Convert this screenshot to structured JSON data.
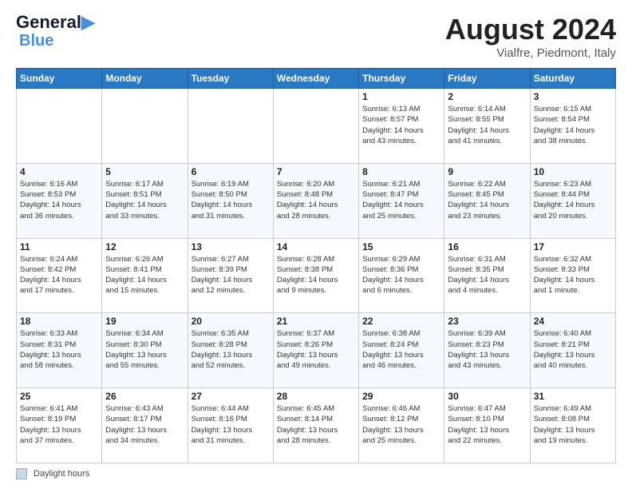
{
  "logo": {
    "line1": "General",
    "line2": "Blue"
  },
  "header": {
    "month": "August 2024",
    "location": "Vialfre, Piedmont, Italy"
  },
  "days_of_week": [
    "Sunday",
    "Monday",
    "Tuesday",
    "Wednesday",
    "Thursday",
    "Friday",
    "Saturday"
  ],
  "weeks": [
    [
      {
        "day": "",
        "info": ""
      },
      {
        "day": "",
        "info": ""
      },
      {
        "day": "",
        "info": ""
      },
      {
        "day": "",
        "info": ""
      },
      {
        "day": "1",
        "info": "Sunrise: 6:13 AM\nSunset: 8:57 PM\nDaylight: 14 hours\nand 43 minutes."
      },
      {
        "day": "2",
        "info": "Sunrise: 6:14 AM\nSunset: 8:55 PM\nDaylight: 14 hours\nand 41 minutes."
      },
      {
        "day": "3",
        "info": "Sunrise: 6:15 AM\nSunset: 8:54 PM\nDaylight: 14 hours\nand 38 minutes."
      }
    ],
    [
      {
        "day": "4",
        "info": "Sunrise: 6:16 AM\nSunset: 8:53 PM\nDaylight: 14 hours\nand 36 minutes."
      },
      {
        "day": "5",
        "info": "Sunrise: 6:17 AM\nSunset: 8:51 PM\nDaylight: 14 hours\nand 33 minutes."
      },
      {
        "day": "6",
        "info": "Sunrise: 6:19 AM\nSunset: 8:50 PM\nDaylight: 14 hours\nand 31 minutes."
      },
      {
        "day": "7",
        "info": "Sunrise: 6:20 AM\nSunset: 8:48 PM\nDaylight: 14 hours\nand 28 minutes."
      },
      {
        "day": "8",
        "info": "Sunrise: 6:21 AM\nSunset: 8:47 PM\nDaylight: 14 hours\nand 25 minutes."
      },
      {
        "day": "9",
        "info": "Sunrise: 6:22 AM\nSunset: 8:45 PM\nDaylight: 14 hours\nand 23 minutes."
      },
      {
        "day": "10",
        "info": "Sunrise: 6:23 AM\nSunset: 8:44 PM\nDaylight: 14 hours\nand 20 minutes."
      }
    ],
    [
      {
        "day": "11",
        "info": "Sunrise: 6:24 AM\nSunset: 8:42 PM\nDaylight: 14 hours\nand 17 minutes."
      },
      {
        "day": "12",
        "info": "Sunrise: 6:26 AM\nSunset: 8:41 PM\nDaylight: 14 hours\nand 15 minutes."
      },
      {
        "day": "13",
        "info": "Sunrise: 6:27 AM\nSunset: 8:39 PM\nDaylight: 14 hours\nand 12 minutes."
      },
      {
        "day": "14",
        "info": "Sunrise: 6:28 AM\nSunset: 8:38 PM\nDaylight: 14 hours\nand 9 minutes."
      },
      {
        "day": "15",
        "info": "Sunrise: 6:29 AM\nSunset: 8:36 PM\nDaylight: 14 hours\nand 6 minutes."
      },
      {
        "day": "16",
        "info": "Sunrise: 6:31 AM\nSunset: 8:35 PM\nDaylight: 14 hours\nand 4 minutes."
      },
      {
        "day": "17",
        "info": "Sunrise: 6:32 AM\nSunset: 8:33 PM\nDaylight: 14 hours\nand 1 minute."
      }
    ],
    [
      {
        "day": "18",
        "info": "Sunrise: 6:33 AM\nSunset: 8:31 PM\nDaylight: 13 hours\nand 58 minutes."
      },
      {
        "day": "19",
        "info": "Sunrise: 6:34 AM\nSunset: 8:30 PM\nDaylight: 13 hours\nand 55 minutes."
      },
      {
        "day": "20",
        "info": "Sunrise: 6:35 AM\nSunset: 8:28 PM\nDaylight: 13 hours\nand 52 minutes."
      },
      {
        "day": "21",
        "info": "Sunrise: 6:37 AM\nSunset: 8:26 PM\nDaylight: 13 hours\nand 49 minutes."
      },
      {
        "day": "22",
        "info": "Sunrise: 6:38 AM\nSunset: 8:24 PM\nDaylight: 13 hours\nand 46 minutes."
      },
      {
        "day": "23",
        "info": "Sunrise: 6:39 AM\nSunset: 8:23 PM\nDaylight: 13 hours\nand 43 minutes."
      },
      {
        "day": "24",
        "info": "Sunrise: 6:40 AM\nSunset: 8:21 PM\nDaylight: 13 hours\nand 40 minutes."
      }
    ],
    [
      {
        "day": "25",
        "info": "Sunrise: 6:41 AM\nSunset: 8:19 PM\nDaylight: 13 hours\nand 37 minutes."
      },
      {
        "day": "26",
        "info": "Sunrise: 6:43 AM\nSunset: 8:17 PM\nDaylight: 13 hours\nand 34 minutes."
      },
      {
        "day": "27",
        "info": "Sunrise: 6:44 AM\nSunset: 8:16 PM\nDaylight: 13 hours\nand 31 minutes."
      },
      {
        "day": "28",
        "info": "Sunrise: 6:45 AM\nSunset: 8:14 PM\nDaylight: 13 hours\nand 28 minutes."
      },
      {
        "day": "29",
        "info": "Sunrise: 6:46 AM\nSunset: 8:12 PM\nDaylight: 13 hours\nand 25 minutes."
      },
      {
        "day": "30",
        "info": "Sunrise: 6:47 AM\nSunset: 8:10 PM\nDaylight: 13 hours\nand 22 minutes."
      },
      {
        "day": "31",
        "info": "Sunrise: 6:49 AM\nSunset: 8:08 PM\nDaylight: 13 hours\nand 19 minutes."
      }
    ]
  ],
  "legend": {
    "label": "Daylight hours"
  }
}
